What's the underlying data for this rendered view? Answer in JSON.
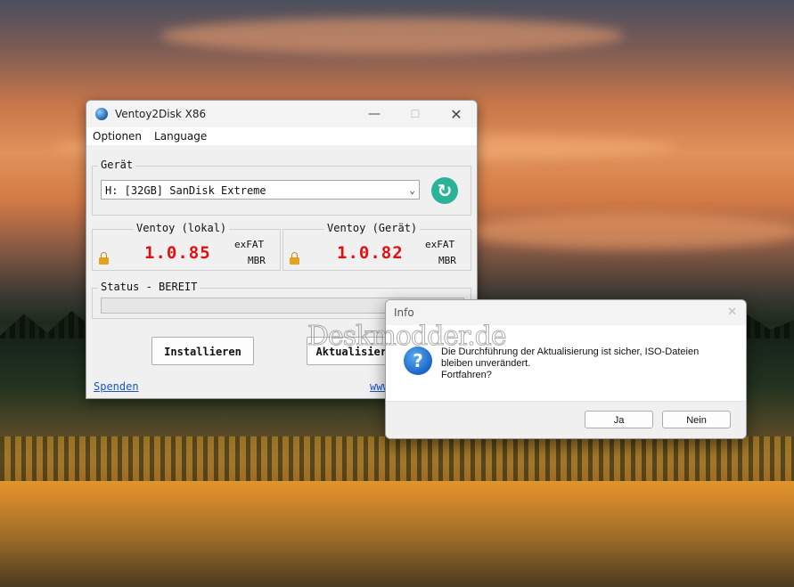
{
  "main_window": {
    "title": "Ventoy2Disk  X86",
    "menu": [
      "Optionen",
      "Language"
    ],
    "device_group_label": "Gerät",
    "device_selected": "H: [32GB] SanDisk Extreme",
    "local": {
      "label": "Ventoy (lokal)",
      "version": "1.0.85",
      "fs": "exFAT",
      "partition": "MBR"
    },
    "device": {
      "label": "Ventoy (Gerät)",
      "version": "1.0.82",
      "fs": "exFAT",
      "partition": "MBR"
    },
    "status_label": "Status - BEREIT",
    "progress_percent": 0,
    "install_button": "Installieren",
    "update_button": "Aktualisieren",
    "donate_link": "Spenden",
    "website_link": "www.ventoy.net"
  },
  "dialog": {
    "title": "Info",
    "message_line1": "Die Durchführung der Aktualisierung ist sicher, ISO-Dateien",
    "message_line2": "bleiben unverändert.",
    "message_line3": "Fortfahren?",
    "yes_button": "Ja",
    "no_button": "Nein"
  },
  "watermark": "Deskmodder.de",
  "colors": {
    "version": "#e01010",
    "refresh": "#2bb39a",
    "link": "#1a56c6",
    "lock": "#e8a11c",
    "question_icon": "#1461c4"
  },
  "icons": {
    "app": "ventoy-icon",
    "refresh": "refresh-icon",
    "lock": "lock-icon",
    "dialog": "question-icon"
  }
}
